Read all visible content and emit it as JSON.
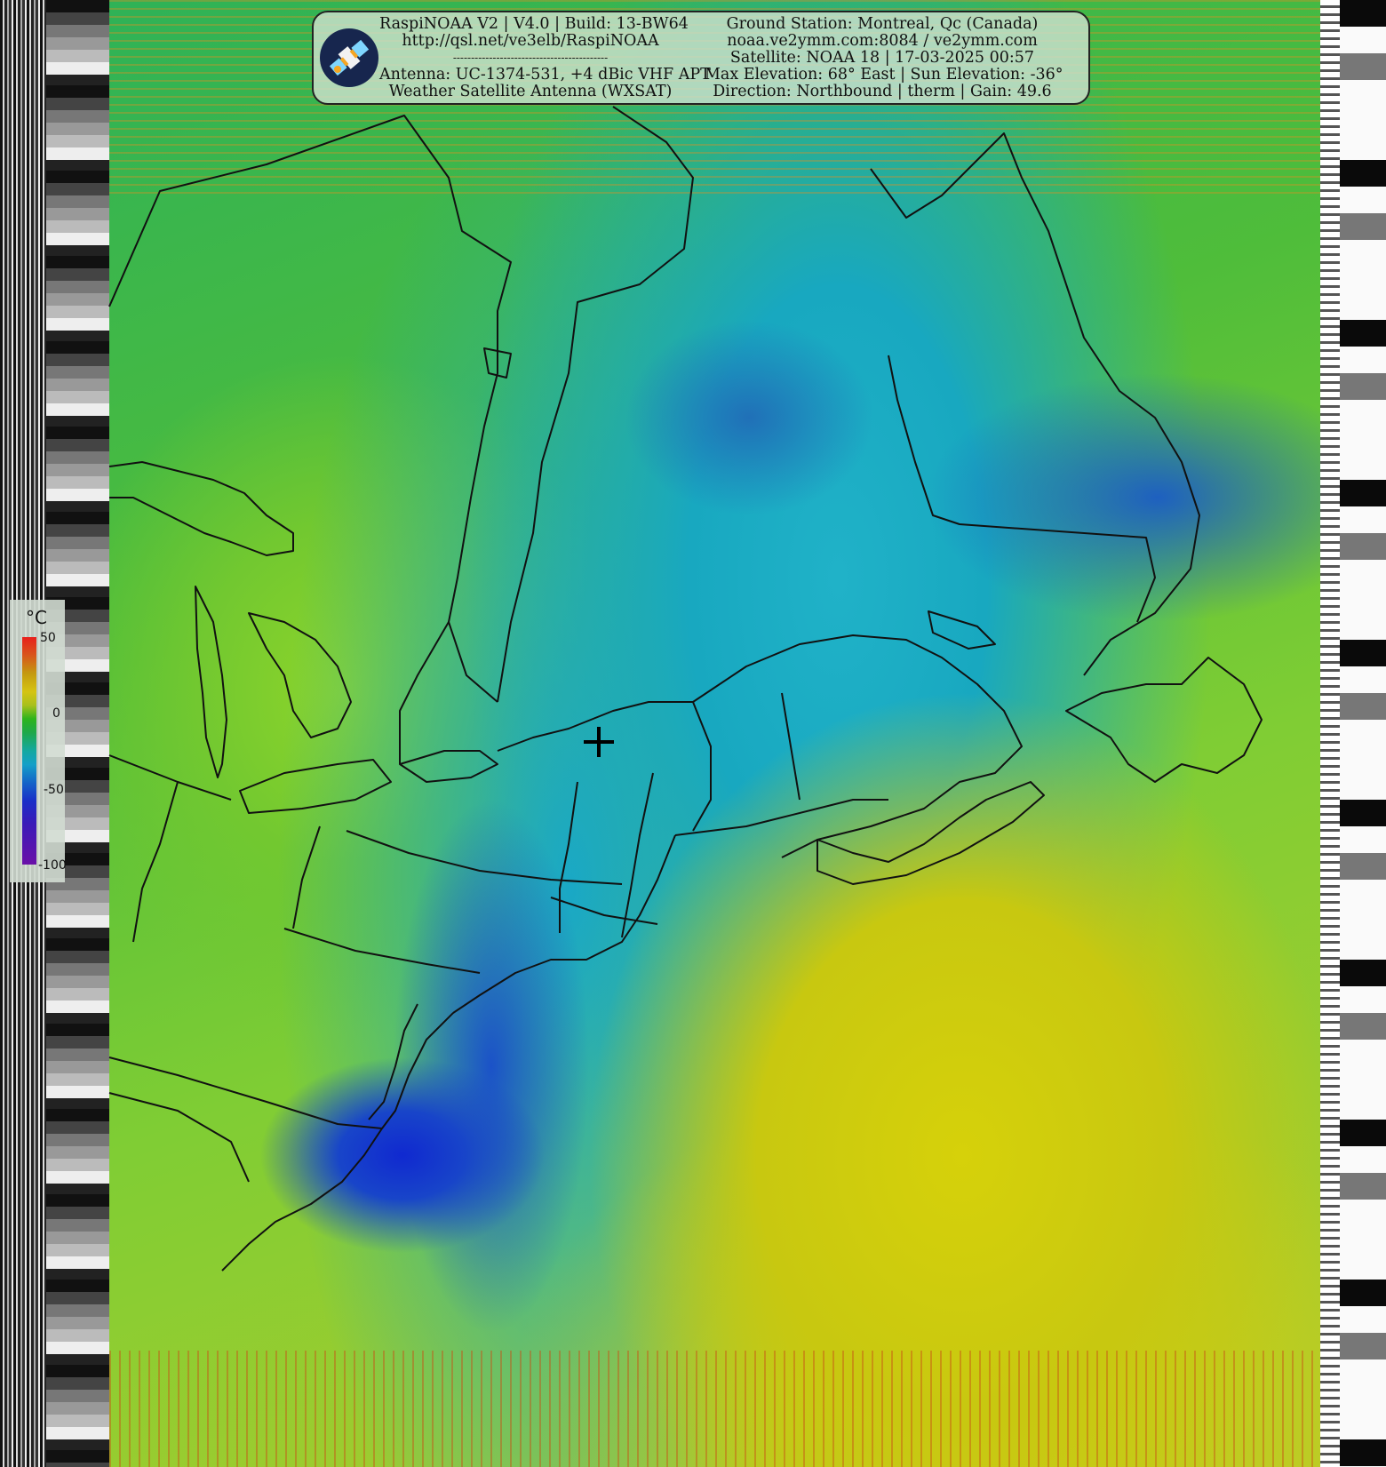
{
  "header": {
    "left_lines": [
      "RaspiNOAA V2 | V4.0 | Build: 13-BW64",
      "http://qsl.net/ve3elb/RaspiNOAA",
      "-------------------------------------------",
      "Antenna: UC-1374-531, +4 dBic VHF APT",
      "Weather Satellite Antenna (WXSAT)"
    ],
    "right_lines": [
      "Ground Station: Montreal, Qc (Canada)",
      "noaa.ve2ymm.com:8084 / ve2ymm.com",
      "Satellite: NOAA 18 | 17-03-2025 00:57",
      "Max Elevation: 68° East | Sun Elevation: -36°",
      "Direction: Northbound | therm | Gain: 49.6"
    ]
  },
  "legend": {
    "unit": "°C",
    "ticks": [
      "50",
      "0",
      "-50",
      "-100"
    ],
    "colors": [
      "#e8201c",
      "#c49a10",
      "#2eb41c",
      "#14a8a0",
      "#1a2fc8",
      "#6a10a8"
    ]
  },
  "map": {
    "type": "thermal satellite image (APT)",
    "marker": "ground-station-crosshair"
  }
}
